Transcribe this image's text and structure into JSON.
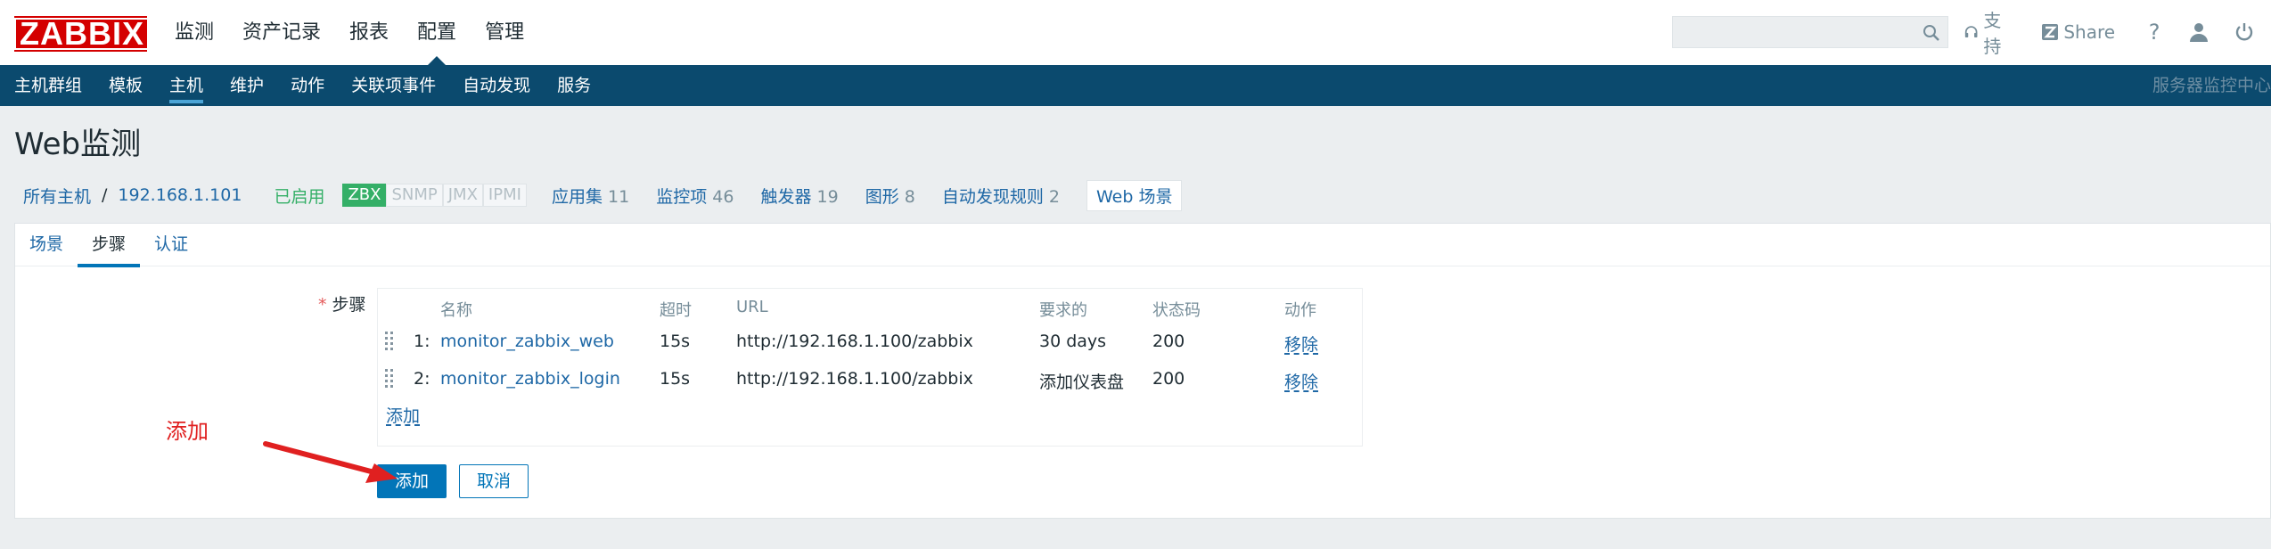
{
  "brand": {
    "logo_text": "ZABBIX"
  },
  "main_nav": [
    "监测",
    "资产记录",
    "报表",
    "配置",
    "管理"
  ],
  "search": {
    "value": "",
    "placeholder": ""
  },
  "top_links": {
    "support": "支持",
    "share": "Share",
    "help": "?"
  },
  "sub_nav": [
    "主机群组",
    "模板",
    "主机",
    "维护",
    "动作",
    "关联项事件",
    "自动发现",
    "服务"
  ],
  "server_name": "服务器监控中心",
  "page_title": "Web监测",
  "breadcrumb": {
    "all_hosts": "所有主机",
    "separator": "/",
    "host": "192.168.1.101",
    "status": "已启用",
    "availability": [
      "ZBX",
      "SNMP",
      "JMX",
      "IPMI"
    ],
    "links": [
      {
        "label": "应用集",
        "count": "11"
      },
      {
        "label": "监控项",
        "count": "46"
      },
      {
        "label": "触发器",
        "count": "19"
      },
      {
        "label": "图形",
        "count": "8"
      },
      {
        "label": "自动发现规则",
        "count": "2"
      }
    ],
    "current_tab": "Web 场景"
  },
  "form_tabs": [
    "场景",
    "步骤",
    "认证"
  ],
  "steps": {
    "label": "步骤",
    "required_mark": "*",
    "headers": {
      "name": "名称",
      "timeout": "超时",
      "url": "URL",
      "required": "要求的",
      "status_codes": "状态码",
      "action": "动作"
    },
    "rows": [
      {
        "index": "1:",
        "name": "monitor_zabbix_web",
        "timeout": "15s",
        "url": "http://192.168.1.100/zabbix",
        "required": "30 days",
        "status_codes": "200",
        "action": "移除"
      },
      {
        "index": "2:",
        "name": "monitor_zabbix_login",
        "timeout": "15s",
        "url": "http://192.168.1.100/zabbix",
        "required": "添加仪表盘",
        "status_codes": "200",
        "action": "移除"
      }
    ],
    "add_link": "添加"
  },
  "buttons": {
    "add": "添加",
    "cancel": "取消"
  },
  "annotation": {
    "label": "添加",
    "color": "#e02020"
  },
  "colors": {
    "brand_red": "#d40000",
    "subnav_bg": "#0b4a6e",
    "link": "#1f68a6",
    "enabled_green": "#34af67",
    "primary_button": "#0275b8"
  }
}
